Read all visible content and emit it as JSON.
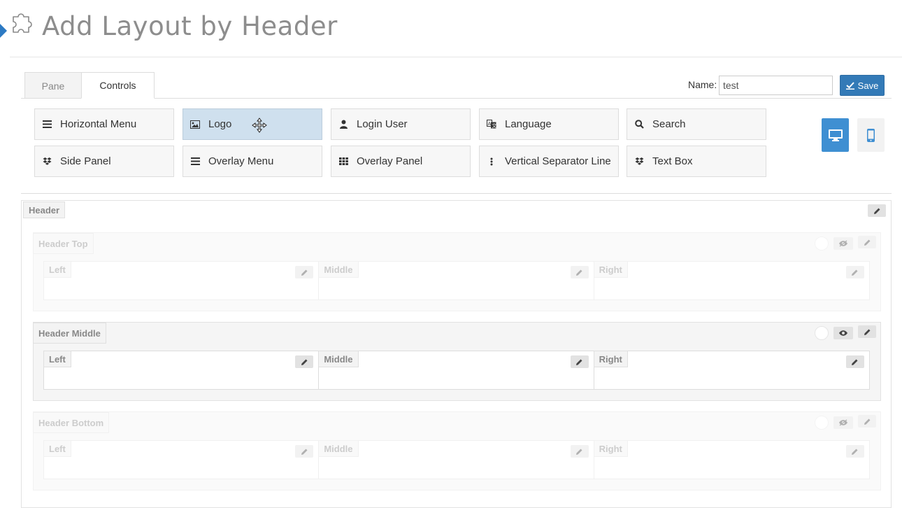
{
  "page": {
    "title": "Add Layout by Header"
  },
  "tabs": [
    {
      "label": "Pane"
    },
    {
      "label": "Controls"
    }
  ],
  "form": {
    "name_label": "Name:",
    "name_value": "test",
    "save_label": "Save"
  },
  "controls": [
    {
      "label": "Horizontal Menu",
      "icon": "bars-icon"
    },
    {
      "label": "Logo",
      "icon": "image-icon",
      "active": true
    },
    {
      "label": "Login User",
      "icon": "user-icon"
    },
    {
      "label": "Language",
      "icon": "translate-icon"
    },
    {
      "label": "Search",
      "icon": "search-icon"
    },
    {
      "label": "Side Panel",
      "icon": "dropbox-icon"
    },
    {
      "label": "Overlay Menu",
      "icon": "bars-icon"
    },
    {
      "label": "Overlay Panel",
      "icon": "grid-icon"
    },
    {
      "label": "Vertical Separator Line",
      "icon": "vertical-dots-icon"
    },
    {
      "label": "Text Box",
      "icon": "dropbox-icon"
    }
  ],
  "header": {
    "label": "Header",
    "sections": [
      {
        "label": "Header Top",
        "columns": [
          "Left",
          "Middle",
          "Right"
        ]
      },
      {
        "label": "Header Middle",
        "columns": [
          "Left",
          "Middle",
          "Right"
        ]
      },
      {
        "label": "Header Bottom",
        "columns": [
          "Left",
          "Middle",
          "Right"
        ]
      }
    ]
  },
  "colors": {
    "accent": "#337ab7",
    "active_control": "#cfe0ee",
    "desktop_button": "#3f8fd2"
  }
}
